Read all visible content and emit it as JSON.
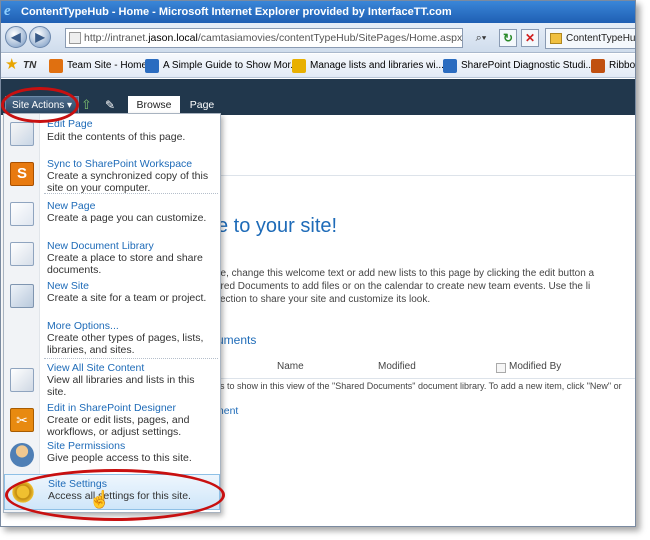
{
  "browser": {
    "title": "ContentTypeHub - Home - Microsoft Internet Explorer provided by InterfaceTT.com",
    "url_prefix": "http://intranet.",
    "url_domain": "jason.local",
    "url_suffix": "/camtasiamovies/contentTypeHub/SitePages/Home.aspx",
    "tab_title": "ContentTypeHub"
  },
  "favorites": [
    {
      "label": "Team Site - Home",
      "color": "#e07010"
    },
    {
      "label": "A Simple Guide to Show Mor...",
      "color": "#2a6cc0"
    },
    {
      "label": "Manage lists and libraries wi...",
      "color": "#e8b000"
    },
    {
      "label": "SharePoint Diagnostic Studi...",
      "color": "#2a6cc0"
    },
    {
      "label": "Ribbon",
      "color": "#c05010"
    }
  ],
  "favorites_tn": "TN",
  "ribbon": {
    "site_actions": "Site Actions ▾",
    "tab_browse": "Browse",
    "tab_page": "Page"
  },
  "page": {
    "welcome": "e to your site!",
    "desc_lines": [
      "ge, change this welcome text or add new lists to this page by clicking the edit button a",
      "ared Documents to add files or on the calendar to create new team events. Use the li",
      "section to share your site and customize its look."
    ],
    "docs_title": "uments",
    "col_name": "Name",
    "col_modified": "Modified",
    "col_modified_by": "Modified By",
    "empty_msg": "ns to show in this view of the \"Shared Documents\" document library. To add a new item, click \"New\" or",
    "add_doc": "ment"
  },
  "menu": [
    {
      "title": "Edit Page",
      "desc": "Edit the contents of this page."
    },
    {
      "title": "Sync to SharePoint Workspace",
      "desc": "Create a synchronized copy of this site on your computer."
    },
    {
      "title": "New Page",
      "desc": "Create a page you can customize."
    },
    {
      "title": "New Document Library",
      "desc": "Create a place to store and share documents."
    },
    {
      "title": "New Site",
      "desc": "Create a site for a team or project."
    },
    {
      "title": "More Options...",
      "desc": "Create other types of pages, lists, libraries, and sites."
    },
    {
      "title": "View All Site Content",
      "desc": "View all libraries and lists in this site."
    },
    {
      "title": "Edit in SharePoint Designer",
      "desc": "Create or edit lists, pages, and workflows, or adjust settings."
    },
    {
      "title": "Site Permissions",
      "desc": "Give people access to this site."
    },
    {
      "title": "Site Settings",
      "desc": "Access all settings for this site."
    }
  ]
}
